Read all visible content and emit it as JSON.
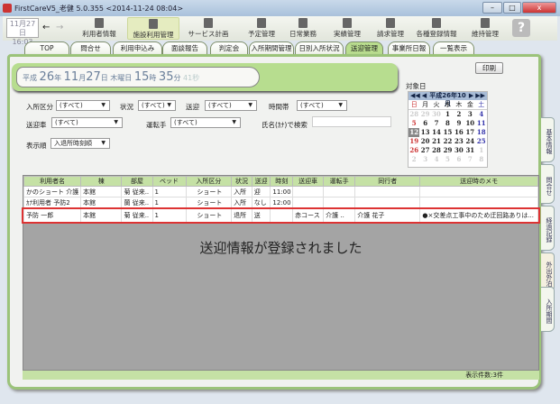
{
  "window": {
    "title": "FirstCareV5_老健 5.0.355 <2014-11-24 08:04>",
    "min": "–",
    "max": "□",
    "close": "x"
  },
  "toolbar": {
    "clock_date": "11月27日",
    "clock_time": "16:03",
    "back": "←",
    "forward": "→",
    "items": [
      {
        "label": "利用者情報",
        "icon": "person-icon"
      },
      {
        "label": "施設利用管理",
        "icon": "building-icon"
      },
      {
        "label": "サービス計画",
        "icon": "document-icon"
      },
      {
        "label": "予定管理",
        "icon": "calendar-icon"
      },
      {
        "label": "日常業務",
        "icon": "clipboard-icon"
      },
      {
        "label": "実績管理",
        "icon": "briefcase-icon"
      },
      {
        "label": "請求管理",
        "icon": "calculator-icon"
      },
      {
        "label": "各種登録情報",
        "icon": "gear-icon"
      },
      {
        "label": "維持管理",
        "icon": "wrench-icon"
      }
    ],
    "help": "?"
  },
  "tabs": [
    "TOP",
    "問合せ",
    "利用申込み",
    "面談報告",
    "判定会",
    "入所期間管理",
    "日別入所状況",
    "送迎管理",
    "事業所日報",
    "一覧表示"
  ],
  "active_tab": "送迎管理",
  "datetime": {
    "era": "平成",
    "year": "26",
    "y": "年",
    "month": "11",
    "m": "月",
    "day": "27",
    "d": "日",
    "weekday": "木曜日",
    "hour": "15",
    "h": "時",
    "minute": "35",
    "mi": "分",
    "second": "41秒"
  },
  "filters": {
    "nyusho_label": "入所区分",
    "nyusho": "(すべて)",
    "status_label": "状況",
    "status": "(すべて)",
    "sougei_label": "送迎",
    "sougei": "(すべて)",
    "time_label": "時間帯",
    "time": "(すべて)",
    "car_label": "送迎車",
    "car": "(すべて)",
    "driver_label": "運転手",
    "driver": "(すべて)",
    "search_label": "氏名(ｶﾅ)で検索",
    "search_value": "",
    "order_label": "表示順",
    "order": "入退所時刻順"
  },
  "print_label": "印刷",
  "calendar": {
    "label": "対象日",
    "title": "平成26年10月",
    "nav_prev2": "◀◀",
    "nav_prev": "◀",
    "nav_next": "▶",
    "nav_next2": "▶▶",
    "weekdays": [
      "日",
      "月",
      "火",
      "水",
      "木",
      "金",
      "土"
    ],
    "weeks": [
      [
        "28",
        "29",
        "30",
        "1",
        "2",
        "3",
        "4"
      ],
      [
        "5",
        "6",
        "7",
        "8",
        "9",
        "10",
        "11"
      ],
      [
        "12",
        "13",
        "14",
        "15",
        "16",
        "17",
        "18"
      ],
      [
        "19",
        "20",
        "21",
        "22",
        "23",
        "24",
        "25"
      ],
      [
        "26",
        "27",
        "28",
        "29",
        "30",
        "31",
        "1"
      ],
      [
        "2",
        "3",
        "4",
        "5",
        "6",
        "7",
        "8"
      ]
    ],
    "selected": "12"
  },
  "table": {
    "headers": [
      "利用者名",
      "棟",
      "部屋",
      "ベッド",
      "入所区分",
      "状況",
      "送迎",
      "時刻",
      "送迎車",
      "運転手",
      "同行者",
      "送迎時のメモ"
    ],
    "rows": [
      [
        "かのショート 介護",
        "本館",
        "菊 従来..",
        "1",
        "ショート",
        "入所",
        "迎",
        "11:00",
        "",
        "",
        "",
        ""
      ],
      [
        "ｶﾅ利用者 予防2",
        "本館",
        "蘭 従来..",
        "1",
        "ショート",
        "入所",
        "なし",
        "12:00",
        "",
        "",
        "",
        ""
      ],
      [
        "予防 一郎",
        "本館",
        "菊 従来..",
        "1",
        "ショート",
        "退所",
        "送",
        "",
        "赤コース",
        "介護 ..",
        "介護 花子",
        "●×交差点工事中のため迂回路ありは..."
      ]
    ]
  },
  "message": "送迎情報が登録されました",
  "footer": "表示件数:3件",
  "side_tabs": [
    "基本情報",
    "問合せ",
    "経過記録",
    "外出外泊",
    "入所期間"
  ]
}
